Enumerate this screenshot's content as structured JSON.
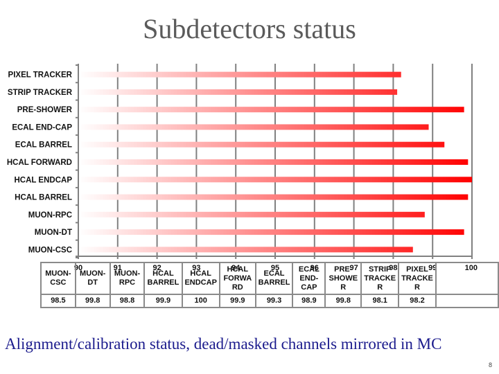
{
  "slide": {
    "title": "Subdetectors status",
    "footer": "Alignment/calibration status, dead/masked channels mirrored in MC",
    "page_number": "8"
  },
  "colors": {
    "bar_start": "#ffffff",
    "bar_end": "#ff0000",
    "grid": "#808080",
    "title": "#5a5a5a",
    "footer": "#1a1a8c"
  },
  "chart_data": {
    "type": "bar",
    "orientation": "horizontal",
    "title": "Subdetectors status",
    "xlabel": "",
    "ylabel": "",
    "xlim": [
      90,
      100
    ],
    "x_ticks": [
      90,
      91,
      92,
      93,
      94,
      95,
      96,
      97,
      98,
      99,
      100
    ],
    "grid": true,
    "categories": [
      "PIXEL TRACKER",
      "STRIP TRACKER",
      "PRE-SHOWER",
      "ECAL END-CAP",
      "ECAL BARREL",
      "HCAL FORWARD",
      "HCAL ENDCAP",
      "HCAL BARREL",
      "MUON-RPC",
      "MUON-DT",
      "MUON-CSC"
    ],
    "values": [
      98.2,
      98.1,
      99.8,
      98.9,
      99.3,
      99.9,
      100,
      99.9,
      98.8,
      99.8,
      98.5
    ],
    "table": {
      "headers": [
        "MUON-CSC",
        "MUON-DT",
        "MUON-RPC",
        "HCAL BARREL",
        "HCAL ENDCAP",
        "HCAL FORWARD",
        "ECAL BARREL",
        "ECAL END-CAP",
        "PRE-SHOWER",
        "STRIP TRACKER",
        "PIXEL TRACKER",
        ""
      ],
      "header_display": [
        "MUON-\nCSC",
        "MUON-\nDT",
        "MUON-\nRPC",
        "HCAL\nBARREL",
        "HCAL\nENDCAP",
        "HCAL\nFORWA\nRD",
        "ECAL\nBARREL",
        "ECAL\nEND-\nCAP",
        "PRE-\nSHOWE\nR",
        "STRIP\nTRACKE\nR",
        "PIXEL\nTRACKE\nR",
        ""
      ],
      "values": [
        "98.5",
        "99.8",
        "98.8",
        "99.9",
        "100",
        "99.9",
        "99.3",
        "98.9",
        "99.8",
        "98.1",
        "98.2",
        ""
      ]
    }
  }
}
